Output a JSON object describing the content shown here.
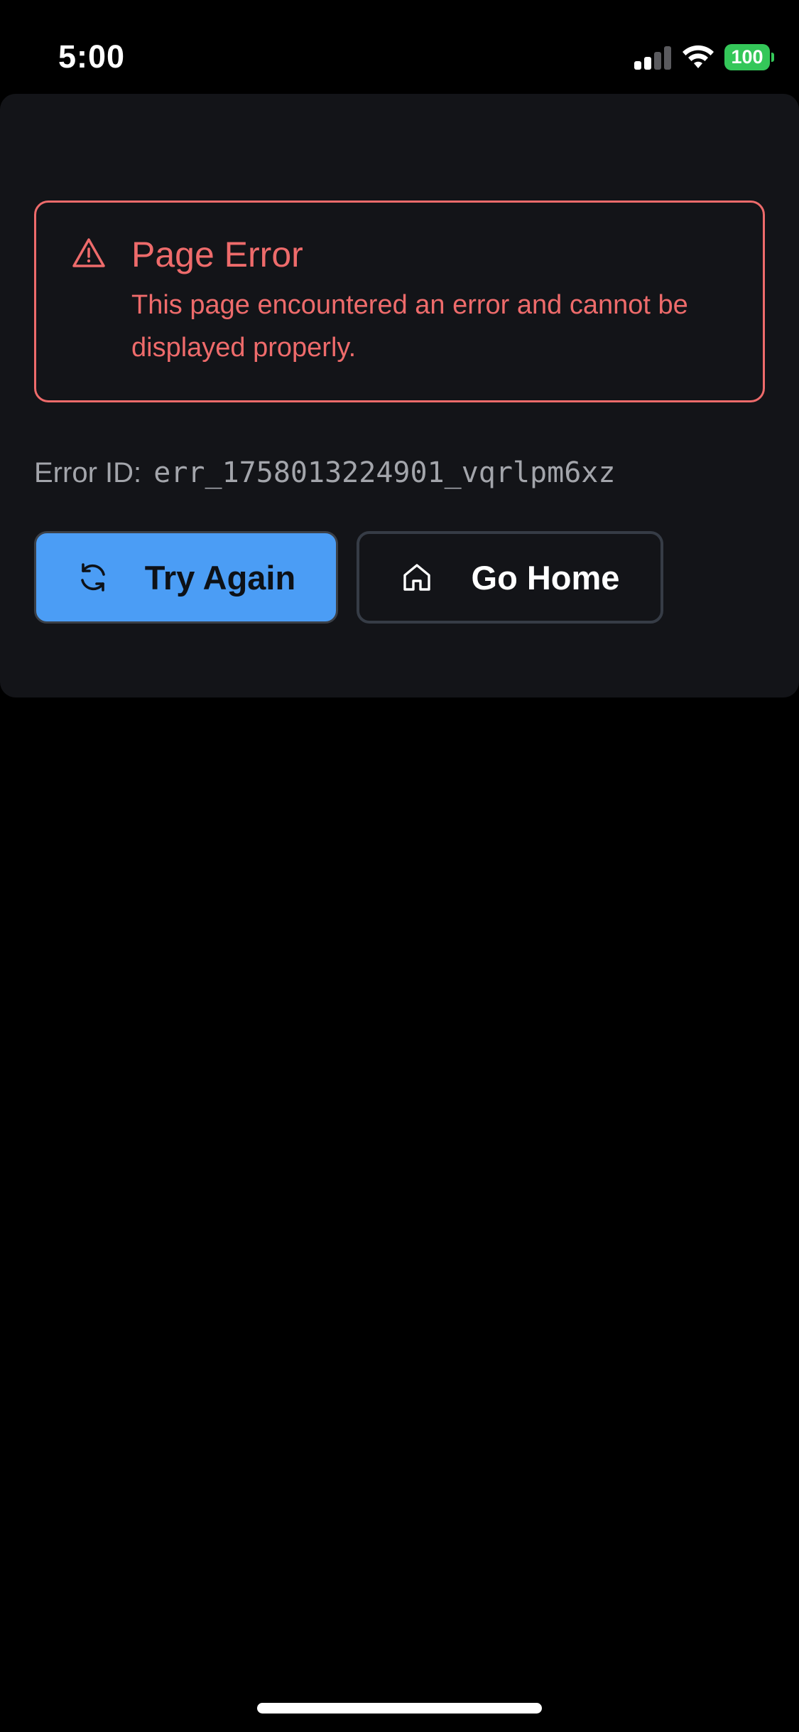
{
  "status_bar": {
    "time": "5:00",
    "battery_level": "100",
    "signal_bars_active": 2,
    "signal_bars_total": 4,
    "battery_color": "#34c759"
  },
  "alert": {
    "icon": "warning-triangle-icon",
    "title": "Page Error",
    "message": "This page encountered an error and cannot be displayed properly.",
    "color": "#ee6b6b"
  },
  "error_id": {
    "label": "Error ID:",
    "value": "err_1758013224901_vqrlpm6xz"
  },
  "actions": {
    "try_again": {
      "label": "Try Again",
      "icon": "refresh-icon",
      "color": "#4b9df5"
    },
    "go_home": {
      "label": "Go Home",
      "icon": "home-icon"
    }
  }
}
